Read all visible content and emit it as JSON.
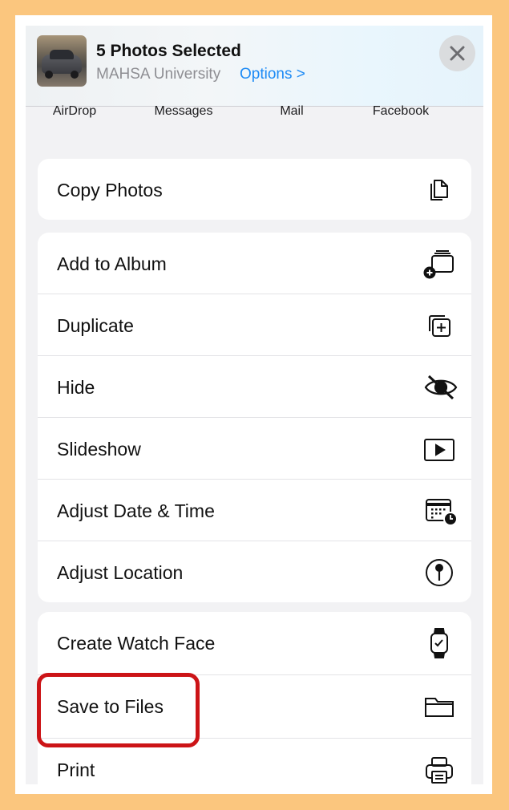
{
  "header": {
    "title": "5 Photos Selected",
    "subtitle": "MAHSA University",
    "options_label": "Options >",
    "close_icon": "close-icon",
    "thumbnail_icon": "photo-thumbnail"
  },
  "apps": [
    "AirDrop",
    "Messages",
    "Mail",
    "Facebook"
  ],
  "groups": [
    {
      "items": [
        {
          "label": "Copy Photos",
          "icon": "copy-icon"
        }
      ]
    },
    {
      "items": [
        {
          "label": "Add to Album",
          "icon": "add-to-album-icon"
        },
        {
          "label": "Duplicate",
          "icon": "duplicate-icon"
        },
        {
          "label": "Hide",
          "icon": "eye-slash-icon"
        },
        {
          "label": "Slideshow",
          "icon": "play-icon"
        },
        {
          "label": "Adjust Date & Time",
          "icon": "calendar-clock-icon"
        },
        {
          "label": "Adjust Location",
          "icon": "location-pin-icon"
        }
      ]
    },
    {
      "items": [
        {
          "label": "Create Watch Face",
          "icon": "watch-icon"
        },
        {
          "label": "Save to Files",
          "icon": "folder-icon"
        },
        {
          "label": "Print",
          "icon": "printer-icon"
        }
      ]
    }
  ],
  "colors": {
    "background": "#fbc67e",
    "accent": "#1c8af5",
    "highlight": "#cc1417"
  }
}
